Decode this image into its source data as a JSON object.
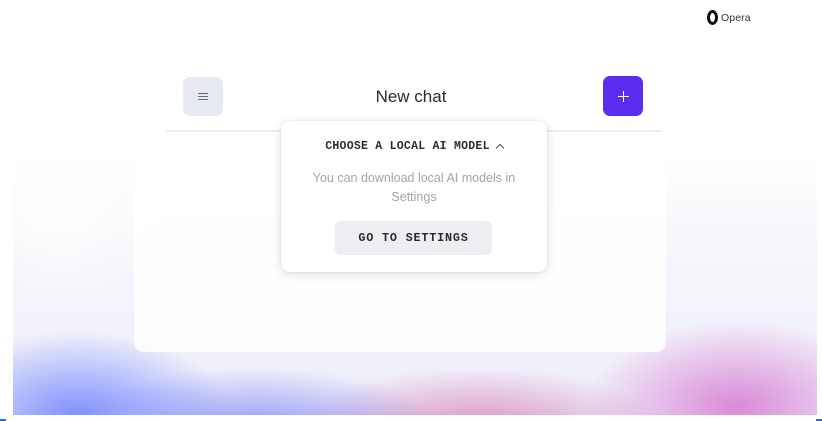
{
  "brand": {
    "name": "Opera",
    "logo_icon": "opera-logo-icon"
  },
  "chat": {
    "title": "New chat",
    "menu_icon": "hamburger-menu-icon",
    "new_chat_icon": "plus-icon"
  },
  "popover": {
    "title": "CHOOSE A LOCAL AI MODEL",
    "chevron_icon": "chevron-up-icon",
    "description": "You can download local AI models in Settings",
    "button_label": "GO TO SETTINGS"
  },
  "colors": {
    "accent": "#5a2df0",
    "button_bg": "#eceef4",
    "menu_bg": "#e7eaf3",
    "muted_text": "#a2a4ad"
  }
}
